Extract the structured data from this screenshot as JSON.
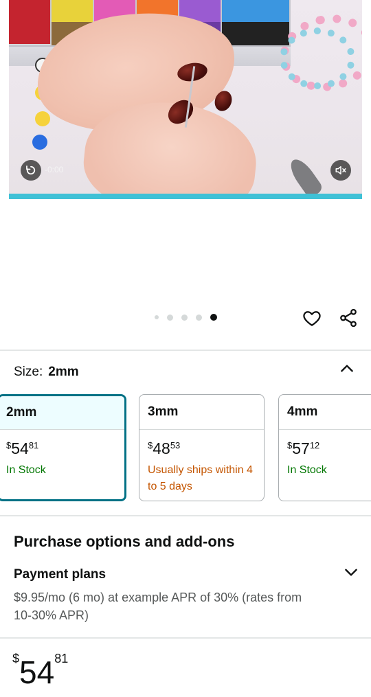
{
  "video": {
    "time": "-0:00"
  },
  "carousel": {
    "dot_count": 5,
    "active_index": 4
  },
  "size": {
    "label": "Size:",
    "selected": "2mm",
    "options": [
      {
        "name": "2mm",
        "price_symbol": "$",
        "price_whole": "54",
        "price_fraction": "81",
        "availability": "In Stock",
        "availability_color": "#007600"
      },
      {
        "name": "3mm",
        "price_symbol": "$",
        "price_whole": "48",
        "price_fraction": "53",
        "availability": "Usually ships within 4 to 5 days",
        "availability_color": "#c45500"
      },
      {
        "name": "4mm",
        "price_symbol": "$",
        "price_whole": "57",
        "price_fraction": "12",
        "availability": "In Stock",
        "availability_color": "#007600"
      }
    ]
  },
  "purchase_options": {
    "title": "Purchase options and add-ons",
    "payment_plans_title": "Payment plans",
    "payment_plans_desc": "$9.95/mo (6 mo) at example APR of 30% (rates from 10-30% APR)"
  },
  "price": {
    "symbol": "$",
    "whole": "54",
    "fraction": "81"
  },
  "colors": {
    "selected_border": "#007185",
    "selected_bg": "#edfdff",
    "video_progress": "#3fc1d6"
  },
  "icons": {
    "replay": "replay-icon",
    "mute": "mute-icon",
    "heart": "heart-icon",
    "share": "share-icon",
    "collapse": "chevron-up-icon",
    "expand": "chevron-down-icon"
  }
}
